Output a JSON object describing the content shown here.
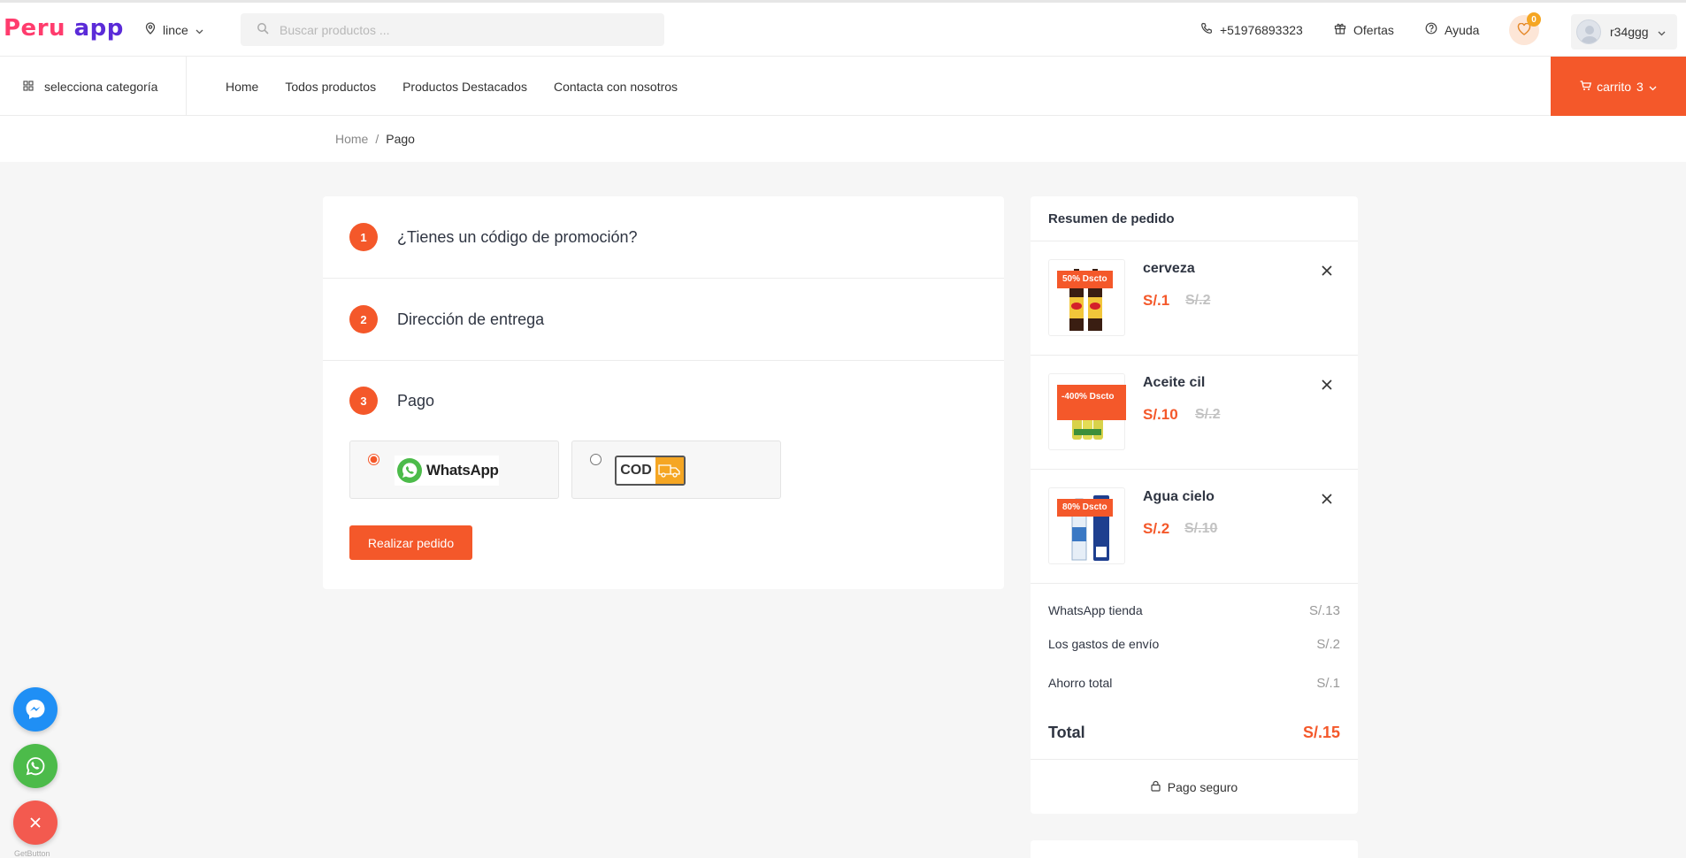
{
  "header": {
    "logo_part1": "Peru",
    "logo_part2": "app",
    "location": "lince",
    "search_placeholder": "Buscar productos ...",
    "phone": "+51976893323",
    "offers": "Ofertas",
    "help": "Ayuda",
    "wishlist_count": "0",
    "username": "r34ggg"
  },
  "nav": {
    "category": "selecciona categoría",
    "links": [
      "Home",
      "Todos productos",
      "Productos Destacados",
      "Contacta con nosotros"
    ],
    "cart_label": "carrito",
    "cart_count": "3"
  },
  "breadcrumb": {
    "home": "Home",
    "sep": "/",
    "current": "Pago"
  },
  "checkout": {
    "steps": [
      {
        "num": "1",
        "title": "¿Tienes un código de promoción?"
      },
      {
        "num": "2",
        "title": "Dirección de entrega"
      },
      {
        "num": "3",
        "title": "Pago"
      }
    ],
    "payment_options": {
      "whatsapp": "WhatsApp",
      "cod": "COD"
    },
    "order_button": "Realizar pedido"
  },
  "summary": {
    "title": "Resumen de pedido",
    "items": [
      {
        "name": "cerveza",
        "price": "S/.1",
        "old_price": "S/.2",
        "discount": "50% Dscto"
      },
      {
        "name": "Aceite cil",
        "price": "S/.10",
        "old_price": "S/.2",
        "discount": "-400% Dscto"
      },
      {
        "name": "Agua cielo",
        "price": "S/.2",
        "old_price": "S/.10",
        "discount": "80% Dscto"
      }
    ],
    "rows": [
      {
        "label": "WhatsApp tienda",
        "value": "S/.13"
      },
      {
        "label": "Los gastos de envío",
        "value": "S/.2"
      },
      {
        "label": "Ahorro total",
        "value": "S/.1"
      }
    ],
    "total_label": "Total",
    "total_value": "S/.15",
    "secure": "Pago seguro"
  },
  "widgets": {
    "getbutton": "GetButton"
  },
  "colors": {
    "accent": "#f4582a",
    "whatsapp": "#4cbb4a",
    "messenger": "#1f8ff5"
  }
}
